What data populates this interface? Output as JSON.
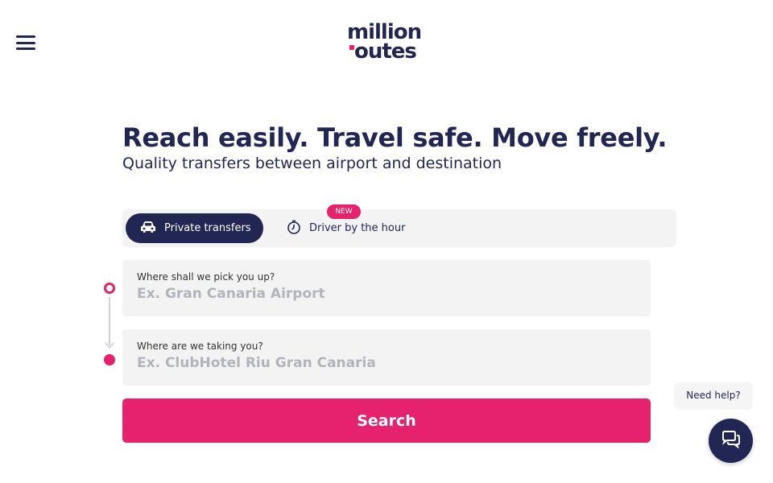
{
  "header": {
    "menu_icon": "hamburger-menu-icon",
    "logo_line1": "million",
    "logo_line2": "outes",
    "brand_accent": "#e5226b",
    "brand_primary": "#222653"
  },
  "hero": {
    "title": "Reach easily. Travel safe. Move freely.",
    "subtitle": "Quality transfers between airport and destination"
  },
  "tabs": {
    "private_label": "Private transfers",
    "private_icon": "car-icon",
    "hour_label": "Driver by the hour",
    "hour_icon": "stopwatch-icon",
    "new_badge": "NEW",
    "selected": "Private transfers"
  },
  "form": {
    "pickup_label": "Where shall we pick you up?",
    "pickup_placeholder": "Ex. Gran Canaria Airport",
    "pickup_value": "",
    "dropoff_label": "Where are we taking you?",
    "dropoff_placeholder": "Ex. ClubHotel Riu Gran Canaria",
    "dropoff_value": "",
    "search_label": "Search"
  },
  "help": {
    "bubble_text": "Need help?",
    "icon": "chat-bubbles-icon"
  }
}
